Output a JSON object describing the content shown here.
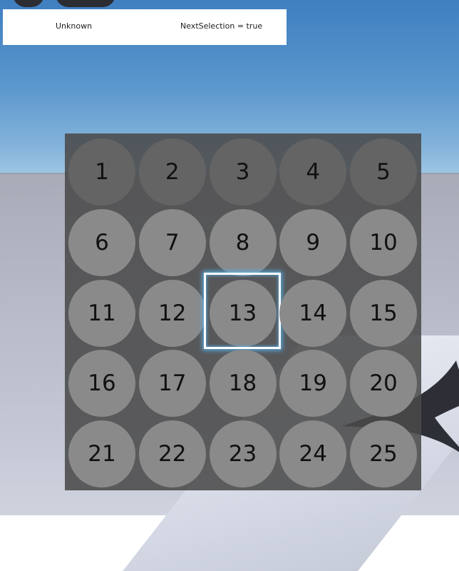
{
  "debug_bar": {
    "left_text": "Unknown",
    "right_text": "NextSelection = true"
  },
  "grid": {
    "columns": 5,
    "rows": 5,
    "dimmed_row": 1,
    "selected_number": "13",
    "cells": [
      "1",
      "2",
      "3",
      "4",
      "5",
      "6",
      "7",
      "8",
      "9",
      "10",
      "11",
      "12",
      "13",
      "14",
      "15",
      "16",
      "17",
      "18",
      "19",
      "20",
      "21",
      "22",
      "23",
      "24",
      "25"
    ]
  },
  "colors": {
    "panel": "#4a4a4a",
    "cell": "#8a8a8a",
    "cell_dim": "#646464",
    "selection_glow": "#56b2eb"
  }
}
